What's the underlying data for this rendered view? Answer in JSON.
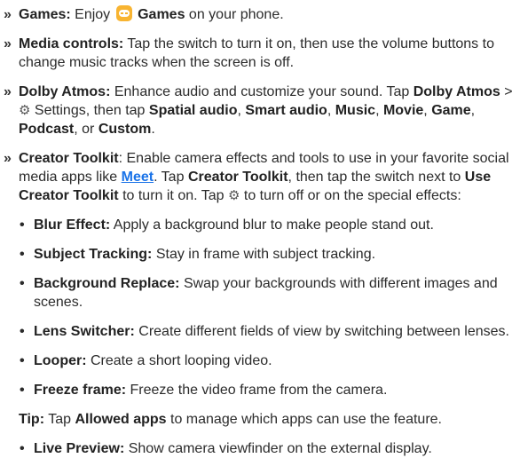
{
  "items": [
    {
      "label": "Games:",
      "t1": "Enjoy",
      "label2": "Games",
      "t2": "on your phone."
    },
    {
      "label": "Media controls:",
      "text": "Tap the switch to turn it on, then use the volume buttons to change music tracks when the screen is off."
    },
    {
      "label": "Dolby Atmos:",
      "t1": "Enhance audio and customize your sound. Tap",
      "b1": "Dolby Atmos",
      "t2": ">",
      "t3": "Settings, then tap",
      "o1": "Spatial audio",
      "o2": "Smart audio",
      "o3": "Music",
      "o4": "Movie",
      "o5": "Game",
      "o6": "Podcast",
      "o7": "Custom",
      "or": "or"
    },
    {
      "label": "Creator Toolkit",
      "t1": ": Enable camera effects and tools to use in your favorite social media apps like",
      "link": "Meet",
      "t2": ". Tap",
      "b1": "Creator Toolkit",
      "t3": ", then tap the switch next to",
      "b2": "Use Creator Toolkit",
      "t4": "to turn it on. Tap",
      "t5": "to turn off or on the special effects:"
    }
  ],
  "effects": [
    {
      "label": "Blur Effect:",
      "text": "Apply a background blur to make people stand out."
    },
    {
      "label": "Subject Tracking:",
      "text": "Stay in frame with subject tracking."
    },
    {
      "label": "Background Replace:",
      "text": "Swap your backgrounds with different images and scenes."
    },
    {
      "label": "Lens Switcher:",
      "text": "Create different fields of view by switching between lenses."
    },
    {
      "label": "Looper:",
      "text": "Create a short looping video."
    },
    {
      "label": "Freeze frame:",
      "text": "Freeze the video frame from the camera."
    }
  ],
  "tip": {
    "label": "Tip:",
    "t1": "Tap",
    "b1": "Allowed apps",
    "t2": "to manage which apps can use the feature."
  },
  "live": {
    "label": "Live Preview:",
    "text": "Show camera viewfinder on the external display."
  },
  "symbols": {
    "arrow": "»",
    "bullet": "•",
    "gear": "⚙"
  }
}
